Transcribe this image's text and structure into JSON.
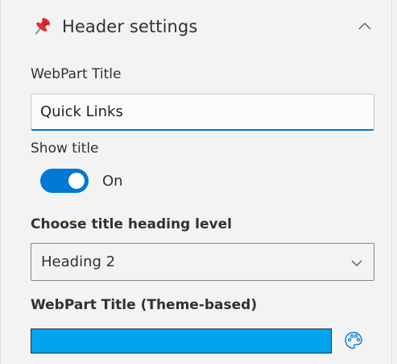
{
  "section": {
    "title": "Header settings",
    "pin_icon": "pushpin-icon",
    "collapse_icon": "chevron-up-icon"
  },
  "webpart_title": {
    "label": "WebPart Title",
    "value": "Quick Links"
  },
  "show_title": {
    "label": "Show title",
    "state_label": "On",
    "checked": true
  },
  "heading_level": {
    "label": "Choose title heading level",
    "selected": "Heading 2",
    "icon": "chevron-down-icon"
  },
  "title_color": {
    "label": "WebPart Title (Theme-based)",
    "color": "#00a4ef",
    "icon": "palette-icon"
  },
  "colors": {
    "accent": "#0078d4",
    "panel_bg": "#f3f3f3",
    "text": "#323130"
  }
}
